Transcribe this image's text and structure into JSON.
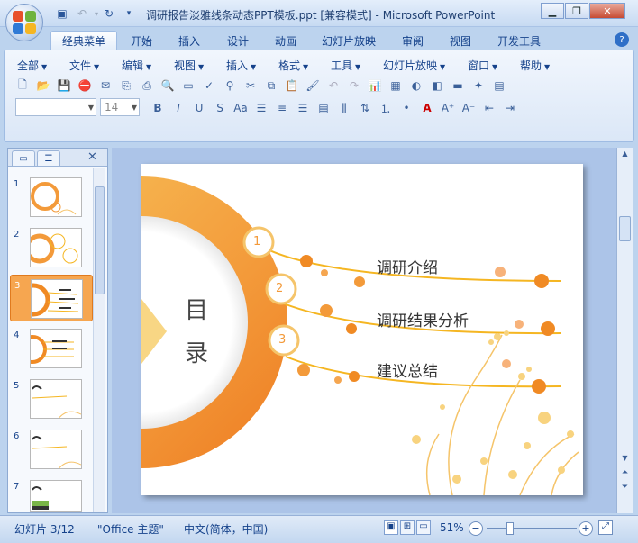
{
  "title_bar": {
    "title": "调研报告淡雅线条动态PPT模板.ppt [兼容模式] - Microsoft PowerPoint",
    "buttons": [
      "minimize",
      "restore",
      "close"
    ]
  },
  "ribbon_tabs": {
    "items": [
      "经典菜单",
      "开始",
      "插入",
      "设计",
      "动画",
      "幻灯片放映",
      "审阅",
      "视图",
      "开发工具"
    ],
    "active": "经典菜单"
  },
  "menu_bar": {
    "items": [
      "全部",
      "文件",
      "编辑",
      "视图",
      "插入",
      "格式",
      "工具",
      "幻灯片放映",
      "窗口",
      "帮助"
    ]
  },
  "format_bar": {
    "font_name": "",
    "font_size": "14"
  },
  "slides": {
    "numbers": [
      "1",
      "2",
      "3",
      "4",
      "5",
      "6",
      "7"
    ],
    "active_index": 2
  },
  "slide": {
    "heading_line1": "目",
    "heading_line2": "录",
    "items": [
      {
        "num": "1",
        "text": "调研介绍"
      },
      {
        "num": "2",
        "text": "调研结果分析"
      },
      {
        "num": "3",
        "text": "建议总结"
      }
    ]
  },
  "status_bar": {
    "slide_info": "幻灯片 3/12",
    "theme": "\"Office 主题\"",
    "language": "中文(简体，中国)",
    "zoom": "51%",
    "zoom_fraction": 0.51
  },
  "colors": {
    "accent_orange": "#f08a24",
    "line_gold": "#f5b622",
    "ribbon_text": "#15428b"
  }
}
